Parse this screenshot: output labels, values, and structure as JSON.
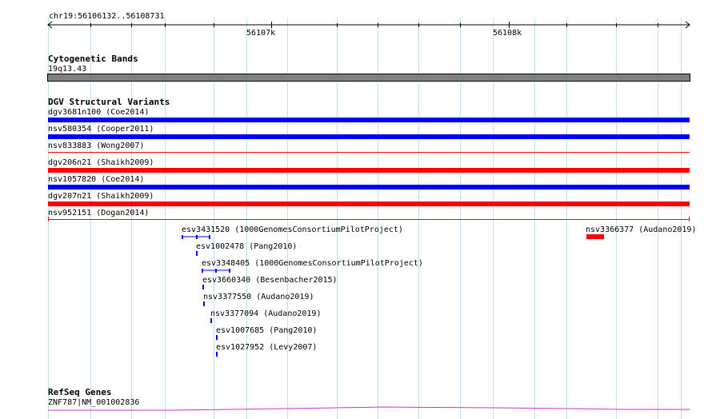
{
  "ruler": {
    "location": "chr19:56106132..56108731",
    "major_labels": [
      "56107k",
      "56108k"
    ]
  },
  "tracks": {
    "cytogenetic": {
      "title": "Cytogenetic Bands",
      "band_label": "19q13.43",
      "band_color": "#808080"
    },
    "dgv": {
      "title": "DGV Structural Variants",
      "variants": [
        {
          "label": "dgv3681n100 (Coe2014)",
          "color": "#0000ff"
        },
        {
          "label": "nsv580354 (Cooper2011)",
          "color": "#0000ff"
        },
        {
          "label": "nsv833883 (Wong2007)",
          "color": "#ff0000"
        },
        {
          "label": "dgv206n21 (Shaikh2009)",
          "color": "#ff0000"
        },
        {
          "label": "nsv1057820 (Coe2014)",
          "color": "#0000ff"
        },
        {
          "label": "dgv207n21 (Shaikh2009)",
          "color": "#ff0000"
        },
        {
          "label": "nsv952151 (Dogan2014)",
          "color": "#ff0000"
        }
      ],
      "small_variants": [
        {
          "label": "esv3431520 (1000GenomesConsortiumPilotProject)",
          "color": "#0000ff"
        },
        {
          "label": "nsv3366377 (Audano2019)",
          "color": "#ff0000"
        },
        {
          "label": "esv1002478 (Pang2010)",
          "color": "#0000ff"
        },
        {
          "label": "esv3348405 (1000GenomesConsortiumPilotProject)",
          "color": "#0000ff"
        },
        {
          "label": "esv3660340 (Besenbacher2015)",
          "color": "#0000ff"
        },
        {
          "label": "nsv3377550 (Audano2019)",
          "color": "#0000ff"
        },
        {
          "label": "nsv3377094 (Audano2019)",
          "color": "#0000ff"
        },
        {
          "label": "esv1007685 (Pang2010)",
          "color": "#0000ff"
        },
        {
          "label": "esv1027952 (Levy2007)",
          "color": "#0000ff"
        }
      ]
    },
    "refseq": {
      "title": "RefSeq Genes",
      "gene_label": "ZNF787|NM_001002836",
      "gene_color": "#cc33cc"
    }
  }
}
